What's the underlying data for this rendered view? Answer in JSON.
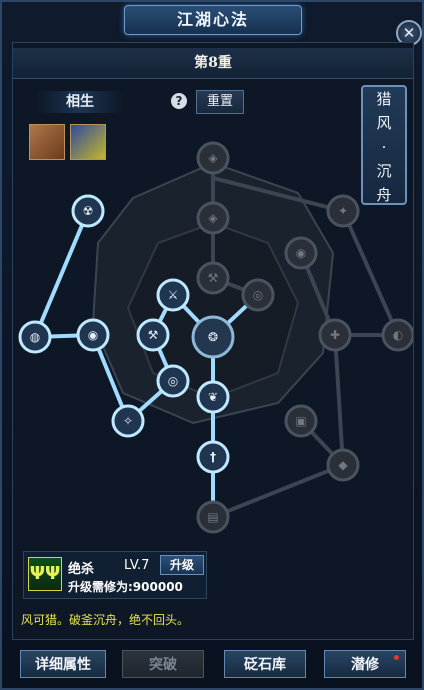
{
  "window": {
    "title": "江湖心法",
    "close_icon": "close-icon"
  },
  "tier": {
    "label": "第8重"
  },
  "tab": {
    "label": "相生"
  },
  "help_icon": "question-icon",
  "reset": {
    "label": "重置"
  },
  "items": [
    "scroll-item-icon",
    "book-item-icon"
  ],
  "side_tab": {
    "chars": [
      "猎",
      "风",
      "·",
      "沉",
      "舟"
    ]
  },
  "skill": {
    "name": "绝杀",
    "level": "LV.7",
    "upgrade_label": "升级",
    "cost": "升级需修为:900000",
    "icon": "warrior-icon"
  },
  "quote": "风可猎。破釜沉舟，绝不回头。",
  "footer": {
    "detail": "详细属性",
    "breakthrough": "突破",
    "stone_library": "砭石库",
    "cultivate": "潜修"
  },
  "colors": {
    "lit": "#bfe9ff",
    "dim": "#4a5360",
    "accent": "#e8e34b"
  }
}
